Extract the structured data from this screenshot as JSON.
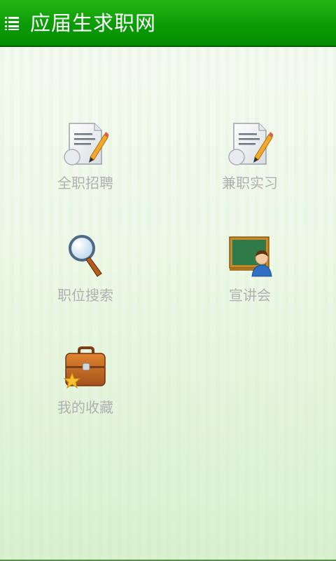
{
  "header": {
    "title": "应届生求职网",
    "menu_icon": "list-menu-icon"
  },
  "menu": [
    {
      "id": "fulltime",
      "label": "全职招聘",
      "icon": "document-pen-icon"
    },
    {
      "id": "parttime",
      "label": "兼职实习",
      "icon": "document-pen-icon"
    },
    {
      "id": "search",
      "label": "职位搜索",
      "icon": "magnifier-icon"
    },
    {
      "id": "seminar",
      "label": "宣讲会",
      "icon": "blackboard-teacher-icon"
    },
    {
      "id": "favorites",
      "label": "我的收藏",
      "icon": "briefcase-star-icon"
    }
  ],
  "colors": {
    "topbar": "#0a9b06",
    "label": "#b0b0b0",
    "background": "#eef8e8"
  }
}
